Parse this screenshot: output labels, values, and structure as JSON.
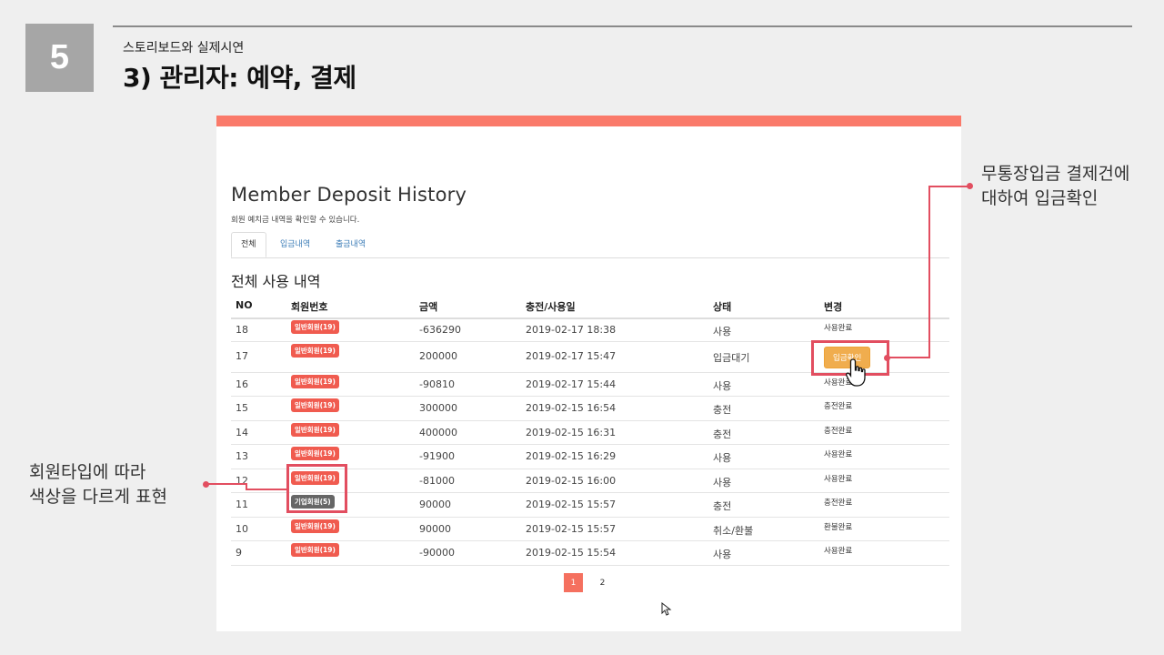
{
  "slide": {
    "number": "5",
    "subtitle": "스토리보드와 실제시연",
    "title": "3) 관리자: 예약, 결제"
  },
  "page": {
    "heading": "Member Deposit History",
    "description": "회원 예치금 내역을 확인할 수 있습니다.",
    "tabs": [
      "전체",
      "입금내역",
      "출금내역"
    ],
    "section_title": "전체 사용 내역"
  },
  "table": {
    "headers": [
      "NO",
      "회원번호",
      "금액",
      "충전/사용일",
      "상태",
      "변경"
    ],
    "rows": [
      {
        "no": "18",
        "member": "일반회원(19)",
        "type": "normal",
        "amount": "-636290",
        "date": "2019-02-17 18:38",
        "status": "사용",
        "change": "사용완료"
      },
      {
        "no": "17",
        "member": "일반회원(19)",
        "type": "normal",
        "amount": "200000",
        "date": "2019-02-17 15:47",
        "status": "입금대기",
        "change": "입금확인"
      },
      {
        "no": "16",
        "member": "일반회원(19)",
        "type": "normal",
        "amount": "-90810",
        "date": "2019-02-17 15:44",
        "status": "사용",
        "change": "사용완료"
      },
      {
        "no": "15",
        "member": "일반회원(19)",
        "type": "normal",
        "amount": "300000",
        "date": "2019-02-15 16:54",
        "status": "충전",
        "change": "충전완료"
      },
      {
        "no": "14",
        "member": "일반회원(19)",
        "type": "normal",
        "amount": "400000",
        "date": "2019-02-15 16:31",
        "status": "충전",
        "change": "충전완료"
      },
      {
        "no": "13",
        "member": "일반회원(19)",
        "type": "normal",
        "amount": "-91900",
        "date": "2019-02-15 16:29",
        "status": "사용",
        "change": "사용완료"
      },
      {
        "no": "12",
        "member": "일반회원(19)",
        "type": "normal",
        "amount": "-81000",
        "date": "2019-02-15 16:00",
        "status": "사용",
        "change": "사용완료"
      },
      {
        "no": "11",
        "member": "기업회원(5)",
        "type": "corp",
        "amount": "90000",
        "date": "2019-02-15 15:57",
        "status": "충전",
        "change": "충전완료"
      },
      {
        "no": "10",
        "member": "일반회원(19)",
        "type": "normal",
        "amount": "90000",
        "date": "2019-02-15 15:57",
        "status": "취소/환불",
        "change": "환불완료"
      },
      {
        "no": "9",
        "member": "일반회원(19)",
        "type": "normal",
        "amount": "-90000",
        "date": "2019-02-15 15:54",
        "status": "사용",
        "change": "사용완료"
      }
    ]
  },
  "pagination": [
    "1",
    "2"
  ],
  "callouts": {
    "right_line1": "무통장입금 결제건에",
    "right_line2": "대하여 입금확인",
    "left_line1": "회원타입에 따라",
    "left_line2": "색상을 다르게 표현"
  },
  "colors": {
    "accent": "#fa7a6a",
    "badge_normal": "#f05b4f",
    "badge_corp": "#666666",
    "confirm_button": "#f0ad4e",
    "highlight": "#e24e60"
  }
}
